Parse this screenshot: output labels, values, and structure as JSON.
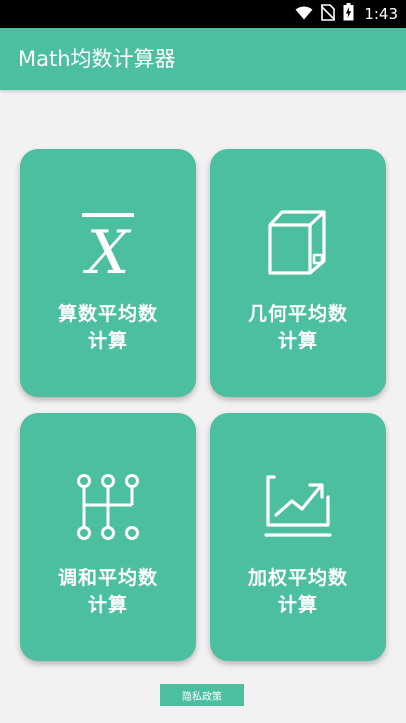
{
  "status_bar": {
    "time": "1:43",
    "icons": [
      "wifi-icon",
      "no-sim-icon",
      "battery-charging-icon"
    ]
  },
  "app_bar": {
    "title": "Math均数计算器"
  },
  "cards": [
    {
      "label": "算数平均数\n计算",
      "icon": "x-bar-icon"
    },
    {
      "label": "几何平均数\n计算",
      "icon": "cube-icon"
    },
    {
      "label": "调和平均数\n计算",
      "icon": "gear-shift-icon"
    },
    {
      "label": "加权平均数\n计算",
      "icon": "trend-chart-icon"
    }
  ],
  "footer": {
    "privacy_label": "隐私政策"
  },
  "colors": {
    "primary": "#4cbfa0",
    "background": "#f2f2f2",
    "status_bar": "#000000",
    "text_on_primary": "#ffffff"
  }
}
